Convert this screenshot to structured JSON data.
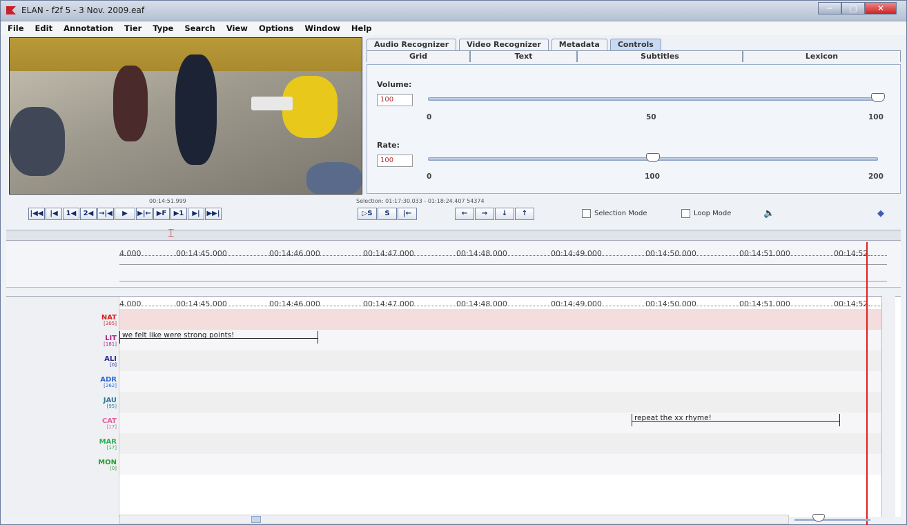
{
  "window": {
    "title": "ELAN - f2f 5 - 3 Nov. 2009.eaf",
    "buttons": [
      "─",
      "□",
      "✕"
    ]
  },
  "menu": [
    "File",
    "Edit",
    "Annotation",
    "Tier",
    "Type",
    "Search",
    "View",
    "Options",
    "Window",
    "Help"
  ],
  "tabs_row1": [
    {
      "label": "Audio Recognizer",
      "active": false
    },
    {
      "label": "Video Recognizer",
      "active": false
    },
    {
      "label": "Metadata",
      "active": false
    },
    {
      "label": "Controls",
      "active": true
    }
  ],
  "tabs_row2": [
    "Grid",
    "Text",
    "Subtitles",
    "Lexicon"
  ],
  "controls": {
    "volume": {
      "label": "Volume:",
      "value": "100",
      "ticks": [
        "0",
        "50",
        "100"
      ],
      "level": 1.0
    },
    "rate": {
      "label": "Rate:",
      "value": "100",
      "ticks": [
        "0",
        "100",
        "200"
      ],
      "level": 0.5
    }
  },
  "media_time": "00:14:51.999",
  "selection": "Selection: 01:17:30.033 - 01:18:24.407 54374",
  "player_buttons": [
    "|◀◀",
    "|◀",
    "1◀",
    "2◀",
    "→|◀",
    "▶",
    "▶|←",
    "▶F",
    "▶1",
    "▶|",
    "▶▶|"
  ],
  "selection_buttons": [
    "▷S",
    "S",
    "|←"
  ],
  "nav_buttons": [
    "←",
    "→",
    "↓",
    "↑"
  ],
  "options": {
    "selection_mode": "Selection Mode",
    "loop_mode": "Loop Mode"
  },
  "ruler_labels": [
    "4.000",
    "00:14:45.000",
    "00:14:46.000",
    "00:14:47.000",
    "00:14:48.000",
    "00:14:49.000",
    "00:14:50.000",
    "00:14:51.000",
    "00:14:52."
  ],
  "tiers": [
    {
      "name": "NAT",
      "count": "[305]",
      "color": "#d42020"
    },
    {
      "name": "LIT",
      "count": "[181]",
      "color": "#b0208a"
    },
    {
      "name": "ALI",
      "count": "[0]",
      "color": "#2a2a8a"
    },
    {
      "name": "ADR",
      "count": "[262]",
      "color": "#2a6ad0"
    },
    {
      "name": "JAU",
      "count": "[95]",
      "color": "#2a7a9a"
    },
    {
      "name": "CAT",
      "count": "[17]",
      "color": "#e060a0"
    },
    {
      "name": "MAR",
      "count": "[17]",
      "color": "#30b050"
    },
    {
      "name": "MON",
      "count": "[0]",
      "color": "#2a9a30"
    }
  ],
  "annotations": [
    {
      "tier": "LIT",
      "text": "we felt like were strong points!"
    },
    {
      "tier": "CAT",
      "text": "repeat the xx rhyme!"
    }
  ],
  "icons": {
    "volume": "speaker-icon",
    "sync": "diamond-icon"
  }
}
